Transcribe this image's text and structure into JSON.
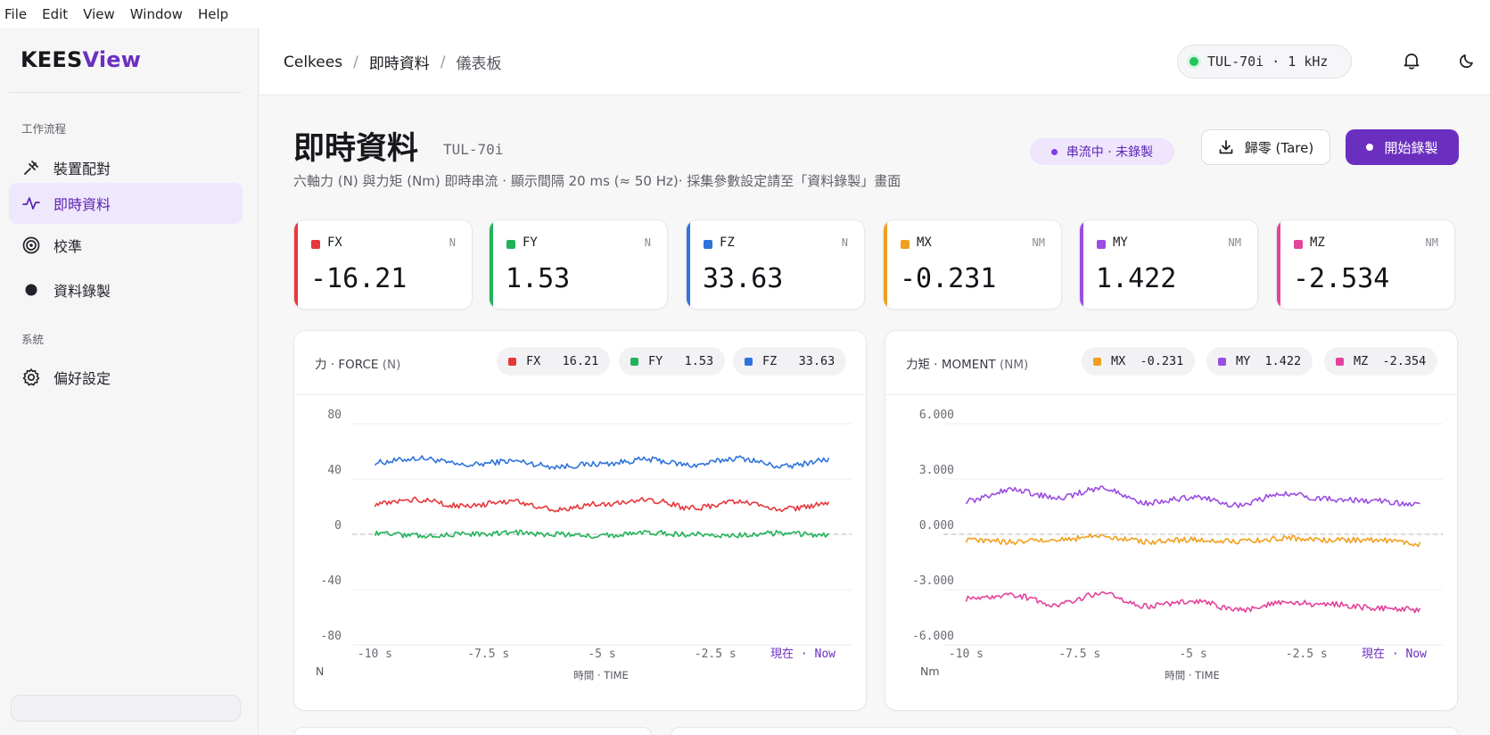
{
  "menubar": [
    "File",
    "Edit",
    "View",
    "Window",
    "Help"
  ],
  "sidebar": {
    "logo_a": "KEES",
    "logo_b": "View",
    "section_workflow": "工作流程",
    "items": [
      {
        "label": "裝置配對",
        "icon": "pairing-icon"
      },
      {
        "label": "即時資料",
        "icon": "activity-icon",
        "active": true
      },
      {
        "label": "校準",
        "icon": "target-icon"
      },
      {
        "label": "資料錄製",
        "icon": "record-dot-icon"
      }
    ],
    "section_system": "系統",
    "system_items": [
      {
        "label": "偏好設定",
        "icon": "gear-icon"
      }
    ]
  },
  "header": {
    "crumbs": [
      "Celkees",
      "即時資料",
      "儀表板"
    ],
    "device": "TUL-70i · 1 kHz",
    "status_color": "#22c55e"
  },
  "page": {
    "title": "即時資料",
    "subtitle": "TUL-70i",
    "description": "六軸力 (N) 與力矩 (Nm) 即時串流 · 顯示間隔 20 ms (≈ 50 Hz)· 採集參數設定請至「資料錄製」畫面",
    "status": "串流中 · 未錄製",
    "tare_label": "歸零 (Tare)",
    "record_label": "開始錄製"
  },
  "cards": [
    {
      "name": "FX",
      "unit": "N",
      "value": "-16.21",
      "color": "#e5383b"
    },
    {
      "name": "FY",
      "unit": "N",
      "value": "1.53",
      "color": "#22b35a"
    },
    {
      "name": "FZ",
      "unit": "N",
      "value": "33.63",
      "color": "#2f73db"
    },
    {
      "name": "MX",
      "unit": "NM",
      "value": "-0.231",
      "color": "#f0a020"
    },
    {
      "name": "MY",
      "unit": "NM",
      "value": "1.422",
      "color": "#9b4de0"
    },
    {
      "name": "MZ",
      "unit": "NM",
      "value": "-2.534",
      "color": "#e4429b"
    }
  ],
  "force_chart": {
    "title_a": "力 · FORCE",
    "title_b": "(N)",
    "chips": [
      {
        "text": "FX   16.21",
        "color": "#e5383b"
      },
      {
        "text": "FY   1.53",
        "color": "#22b35a"
      },
      {
        "text": "FZ   33.63",
        "color": "#2f73db"
      }
    ],
    "unit_label": "N"
  },
  "moment_chart": {
    "title_a": "力矩 · MOMENT",
    "title_b": "(NM)",
    "chips": [
      {
        "text": "MX  -0.231",
        "color": "#f0a020"
      },
      {
        "text": "MY  1.422",
        "color": "#9b4de0"
      },
      {
        "text": "MZ  -2.354",
        "color": "#e4429b"
      }
    ],
    "unit_label": "Nm"
  },
  "chart_data": [
    {
      "type": "line",
      "title": "力 · FORCE (N)",
      "xlabel": "時間 · TIME",
      "ylabel": "N",
      "x_ticks": [
        "-10 s",
        "-7.5 s",
        "-5 s",
        "-2.5 s",
        "現在 · Now"
      ],
      "xlim": [
        -10.5,
        0.5
      ],
      "y_ticks": [
        "80",
        "40",
        "0",
        "-40",
        "-80"
      ],
      "ylim": [
        -80,
        80
      ],
      "grid": true,
      "zero_line": true,
      "x": [
        -10,
        -9,
        -8,
        -7,
        -6,
        -5,
        -4,
        -3,
        -2,
        -1,
        0
      ],
      "series": [
        {
          "name": "FZ",
          "color": "#2f73db",
          "values": [
            52,
            55,
            50,
            53,
            49,
            51,
            54,
            50,
            55,
            49,
            54
          ]
        },
        {
          "name": "FX",
          "color": "#e5383b",
          "values": [
            22,
            25,
            20,
            24,
            18,
            22,
            25,
            19,
            23,
            18,
            22
          ]
        },
        {
          "name": "FY",
          "color": "#22b35a",
          "values": [
            1,
            -1,
            0,
            1,
            0,
            -1,
            1,
            0,
            -1,
            1,
            -1
          ]
        }
      ]
    },
    {
      "type": "line",
      "title": "力矩 · MOMENT (NM)",
      "xlabel": "時間 · TIME",
      "ylabel": "Nm",
      "x_ticks": [
        "-10 s",
        "-7.5 s",
        "-5 s",
        "-2.5 s",
        "現在 · Now"
      ],
      "xlim": [
        -10.5,
        0.5
      ],
      "y_ticks": [
        "6.000",
        "3.000",
        "0.000",
        "-3.000",
        "-6.000"
      ],
      "ylim": [
        -6,
        6
      ],
      "grid": true,
      "zero_line": true,
      "x": [
        -10,
        -9,
        -8,
        -7,
        -6,
        -5,
        -4,
        -3,
        -2,
        -1,
        0
      ],
      "series": [
        {
          "name": "MY",
          "color": "#9b4de0",
          "values": [
            1.8,
            2.4,
            2.0,
            2.5,
            1.7,
            2.0,
            1.6,
            2.2,
            1.9,
            1.8,
            1.6
          ]
        },
        {
          "name": "MX",
          "color": "#f0a020",
          "values": [
            -0.3,
            -0.4,
            -0.3,
            -0.1,
            -0.4,
            -0.3,
            -0.4,
            -0.2,
            -0.3,
            -0.3,
            -0.5
          ]
        },
        {
          "name": "MZ",
          "color": "#e4429b",
          "values": [
            -3.5,
            -3.3,
            -3.8,
            -3.2,
            -3.9,
            -3.6,
            -4.1,
            -3.7,
            -3.8,
            -4.0,
            -4.1
          ]
        }
      ]
    }
  ]
}
